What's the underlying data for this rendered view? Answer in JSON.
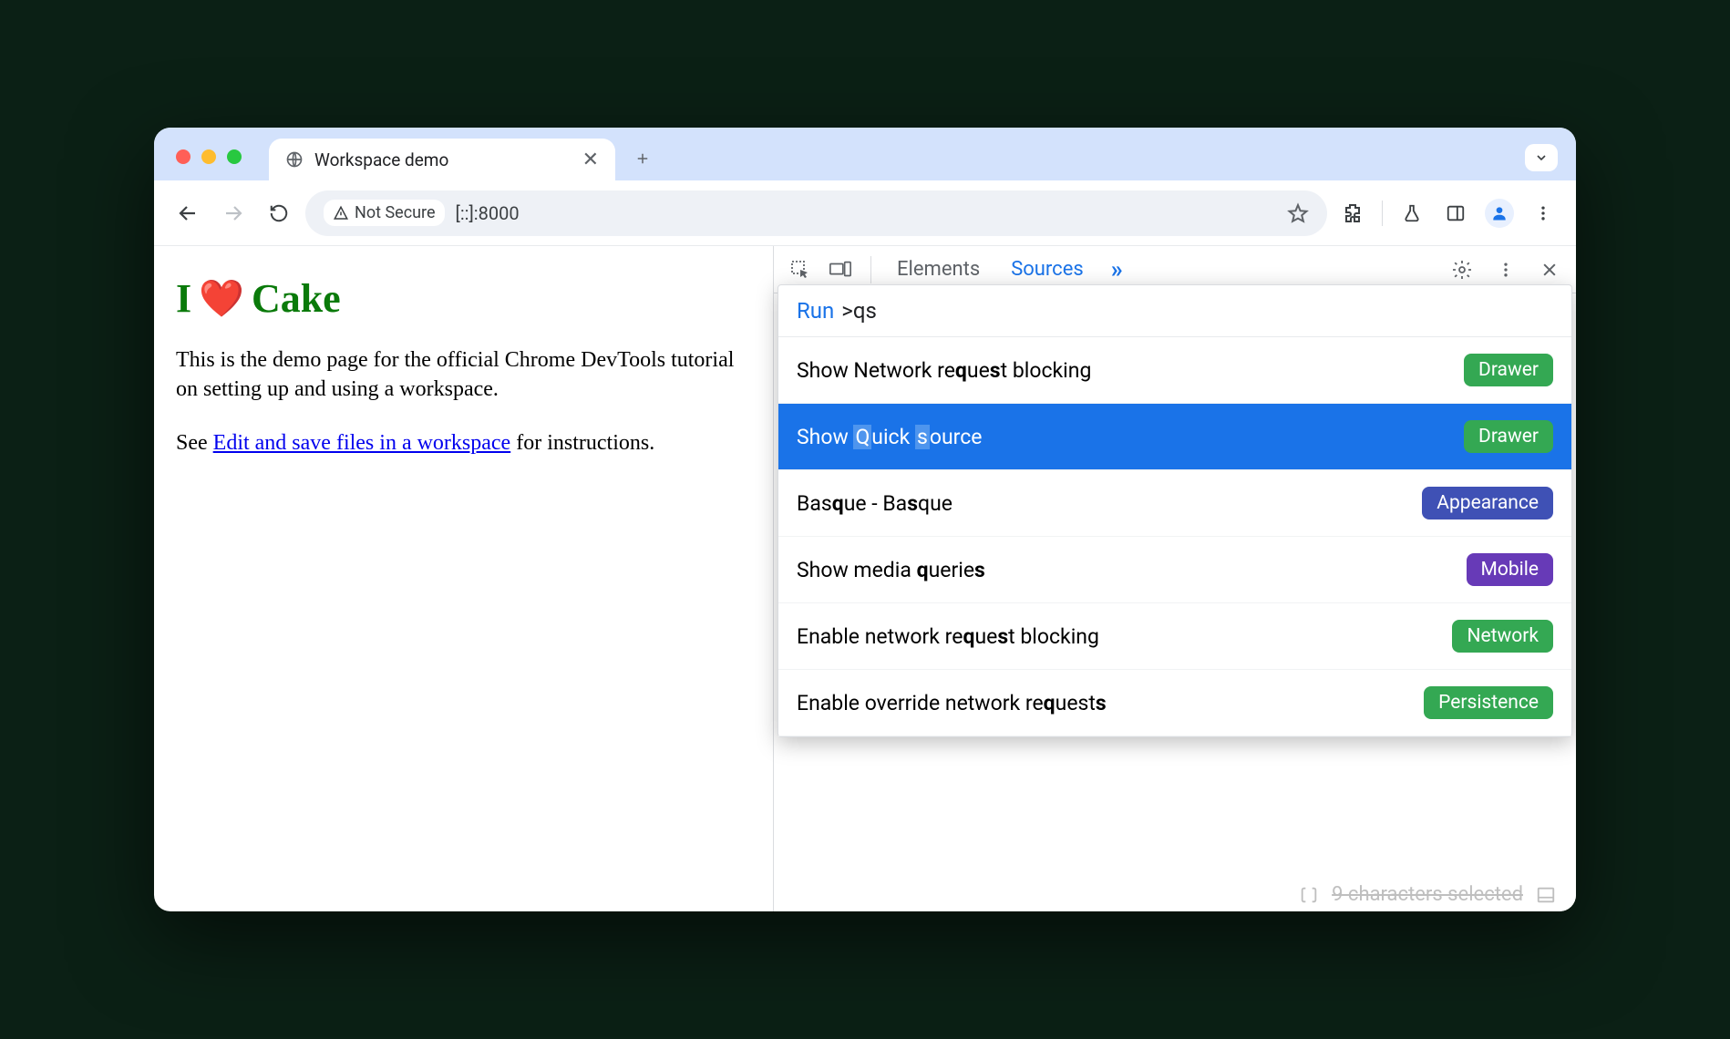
{
  "tab": {
    "title": "Workspace demo"
  },
  "omnibox": {
    "security": "Not Secure",
    "url": "[::]:8000"
  },
  "page": {
    "h1_prefix": "I",
    "h1_suffix": "Cake",
    "para1": "This is the demo page for the official Chrome DevTools tutorial on setting up and using a workspace.",
    "para2_prefix": "See ",
    "link": "Edit and save files in a workspace",
    "para2_suffix": " for instructions."
  },
  "devtools": {
    "tabs": {
      "elements": "Elements",
      "sources": "Sources"
    },
    "cmd": {
      "run_label": "Run",
      "query": ">qs",
      "items": [
        {
          "html": "Show Network re<b>q</b>ue<b>s</b>t blocking",
          "badge": "Drawer",
          "badgeClass": "b-green",
          "sel": false
        },
        {
          "html": "Show <span class='hl'>Q</span>uick <span class='hl'>s</span>ource",
          "badge": "Drawer",
          "badgeClass": "b-green",
          "sel": true
        },
        {
          "html": "Bas<b>q</b>ue - Ba<b>s</b>que",
          "badge": "Appearance",
          "badgeClass": "b-indigo",
          "sel": false
        },
        {
          "html": "Show media <b>q</b>uerie<b>s</b>",
          "badge": "Mobile",
          "badgeClass": "b-purple",
          "sel": false
        },
        {
          "html": "Enable network re<b>q</b>ue<b>s</b>t blocking",
          "badge": "Network",
          "badgeClass": "b-green",
          "sel": false
        },
        {
          "html": "Enable override network re<b>q</b>uest<b>s</b>",
          "badge": "Persistence",
          "badgeClass": "b-green",
          "sel": false
        }
      ]
    },
    "footer": "9 characters selected"
  }
}
